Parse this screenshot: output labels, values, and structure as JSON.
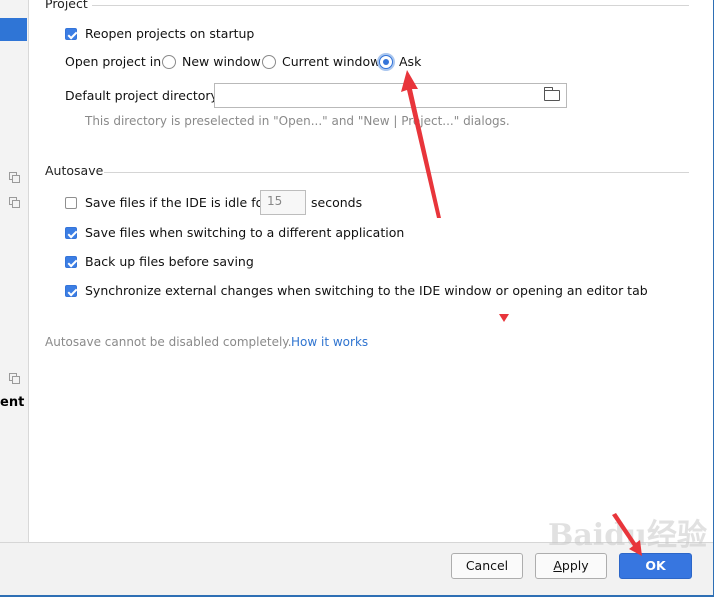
{
  "project_section": {
    "title": "Project",
    "reopen_label": "Reopen projects on startup",
    "reopen_checked": true,
    "open_in_label": "Open project in",
    "radio_options": [
      {
        "label": "New window",
        "selected": false
      },
      {
        "label": "Current window",
        "selected": false
      },
      {
        "label": "Ask",
        "selected": true
      }
    ],
    "default_dir_label": "Default project directory:",
    "default_dir_value": "",
    "default_dir_hint": "This directory is preselected in \"Open...\" and \"New | Project...\" dialogs."
  },
  "autosave_section": {
    "title": "Autosave",
    "idle_label_before": "Save files if the IDE is idle for",
    "idle_checked": false,
    "idle_seconds": "15",
    "idle_label_after": "seconds",
    "options": [
      {
        "label": "Save files when switching to a different application",
        "checked": true
      },
      {
        "label": "Back up files before saving",
        "checked": true
      },
      {
        "label": "Synchronize external changes when switching to the IDE window or opening an editor tab",
        "checked": true
      }
    ],
    "note": "Autosave cannot be disabled completely.",
    "note_link": "How it works"
  },
  "sidebar": {
    "partial_label": "ent"
  },
  "buttons": {
    "cancel": "Cancel",
    "apply": "Apply",
    "ok": "OK"
  },
  "watermark": "Baidu经验",
  "colors": {
    "accent": "#3776e0",
    "link": "#2f74d0",
    "annotation_red": "#e8353b"
  }
}
